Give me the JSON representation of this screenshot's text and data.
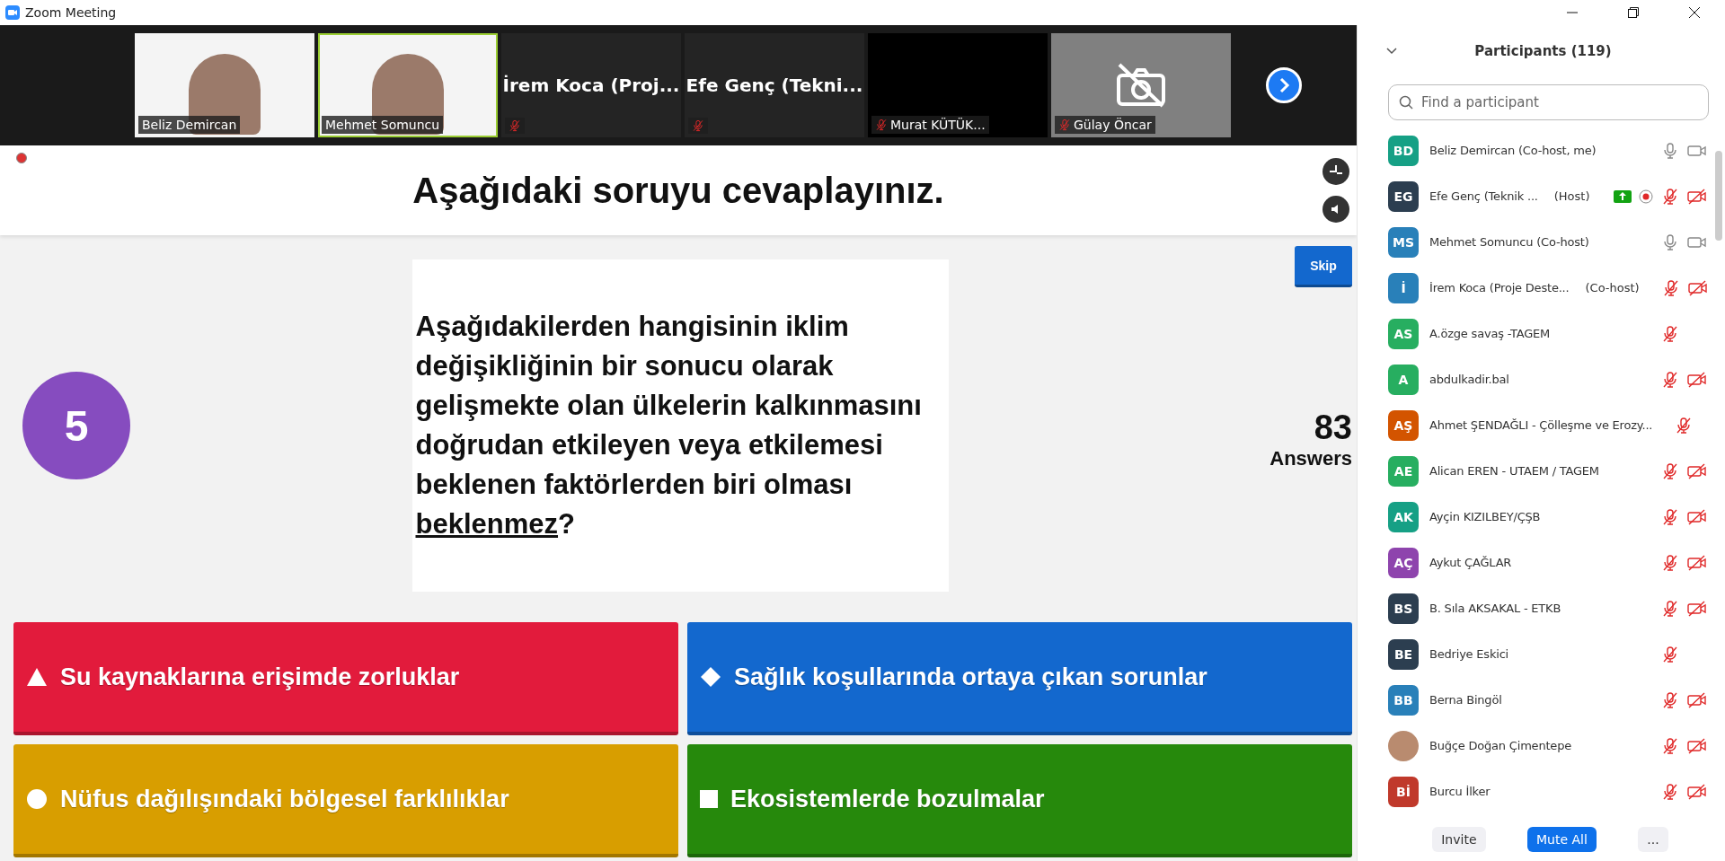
{
  "window": {
    "title": "Zoom Meeting"
  },
  "video_strip": [
    {
      "name": "Beliz Demircan",
      "kind": "video",
      "muted": false,
      "speaking": false
    },
    {
      "name": "Mehmet Somuncu",
      "kind": "video",
      "muted": false,
      "speaking": true
    },
    {
      "name": "İrem Koca (Proj...",
      "kind": "name",
      "muted": true,
      "speaking": false
    },
    {
      "name": "Efe Genç (Tekni...",
      "kind": "name",
      "muted": true,
      "speaking": false
    },
    {
      "name": "Murat KÜTÜK...",
      "kind": "black",
      "muted": true,
      "speaking": false
    },
    {
      "name": "Gülay Öncar",
      "kind": "camera-off",
      "muted": true,
      "speaking": false
    }
  ],
  "slide": {
    "header": "Aşağıdaki soruyu cevaplayınız.",
    "skip": "Skip",
    "number": "5",
    "answers_count": "83",
    "answers_label": "Answers",
    "question": {
      "text": "Aşağıdakilerden hangisinin iklim değişikliğinin bir sonucu olarak gelişmekte olan ülkelerin kalkınmasını doğrudan etkileyen veya etkilemesi beklenen faktörlerden biri olması ",
      "emphasis": "beklenmez",
      "end": "?"
    },
    "options": [
      {
        "text": "Su kaynaklarına erişimde zorluklar",
        "kind": "triangle",
        "color": "#e21b3c"
      },
      {
        "text": "Sağlık koşullarında ortaya çıkan sorunlar",
        "kind": "diamond",
        "color": "#1368ce"
      },
      {
        "text": "Nüfus dağılışındaki bölgesel farklılıklar",
        "kind": "circle",
        "color": "#d89e00"
      },
      {
        "text": "Ekosistemlerde bozulmalar",
        "kind": "square",
        "color": "#26890c"
      }
    ]
  },
  "participants": {
    "title": "Participants (119)",
    "search": {
      "placeholder": "Find a participant"
    },
    "list": [
      {
        "initials": "BD",
        "color": "#16a085",
        "name": "Beliz Demircan (Co-host, me)",
        "mic_muted": false,
        "video_off": false
      },
      {
        "initials": "EG",
        "color": "#2c3e50",
        "name": "Efe Genç (Teknik ...",
        "role": "(Host)",
        "sharing": true,
        "recording": true,
        "mic_muted": true,
        "video_off": true
      },
      {
        "initials": "MS",
        "color": "#2980b9",
        "name": "Mehmet Somuncu (Co-host)",
        "mic_muted": false,
        "video_off": false
      },
      {
        "initials": "İ",
        "color": "#2980b9",
        "name": "İrem Koca (Proje Deste...",
        "role": "(Co-host)",
        "mic_muted": true,
        "video_off": true
      },
      {
        "initials": "AS",
        "color": "#27ae60",
        "name": "A.özge savaş -TAGEM",
        "mic_muted": true
      },
      {
        "initials": "A",
        "color": "#27ae60",
        "name": "abdulkadir.bal",
        "mic_muted": true,
        "video_off": true
      },
      {
        "initials": "AŞ",
        "color": "#d35400",
        "name": "Ahmet ŞENDAĞLI - Çölleşme ve Erozy...",
        "mic_muted": true
      },
      {
        "initials": "AE",
        "color": "#27ae60",
        "name": "Alican EREN - UTAEM / TAGEM",
        "mic_muted": true,
        "video_off": true
      },
      {
        "initials": "AK",
        "color": "#16a085",
        "name": "Ayçin KIZILBEY/ÇŞB",
        "mic_muted": true,
        "video_off": true
      },
      {
        "initials": "AÇ",
        "color": "#8e44ad",
        "name": "Aykut ÇAĞLAR",
        "mic_muted": true,
        "video_off": true
      },
      {
        "initials": "BS",
        "color": "#2c3e50",
        "name": "B. Sıla AKSAKAL - ETKB",
        "mic_muted": true,
        "video_off": true
      },
      {
        "initials": "BE",
        "color": "#2c3e50",
        "name": "Bedriye Eskici",
        "mic_muted": true
      },
      {
        "initials": "BB",
        "color": "#2980b9",
        "name": "Berna Bingöl",
        "mic_muted": true,
        "video_off": true
      },
      {
        "kind": "photo",
        "name": "Buğçe Doğan Çimentepe",
        "mic_muted": true,
        "video_off": true
      },
      {
        "initials": "Bİ",
        "color": "#c0392b",
        "name": "Burcu İlker",
        "mic_muted": true,
        "video_off": true
      }
    ],
    "buttons": [
      {
        "label": "Invite",
        "primary": false
      },
      {
        "label": "Mute All",
        "primary": true
      },
      {
        "label": "...",
        "primary": false
      }
    ]
  }
}
